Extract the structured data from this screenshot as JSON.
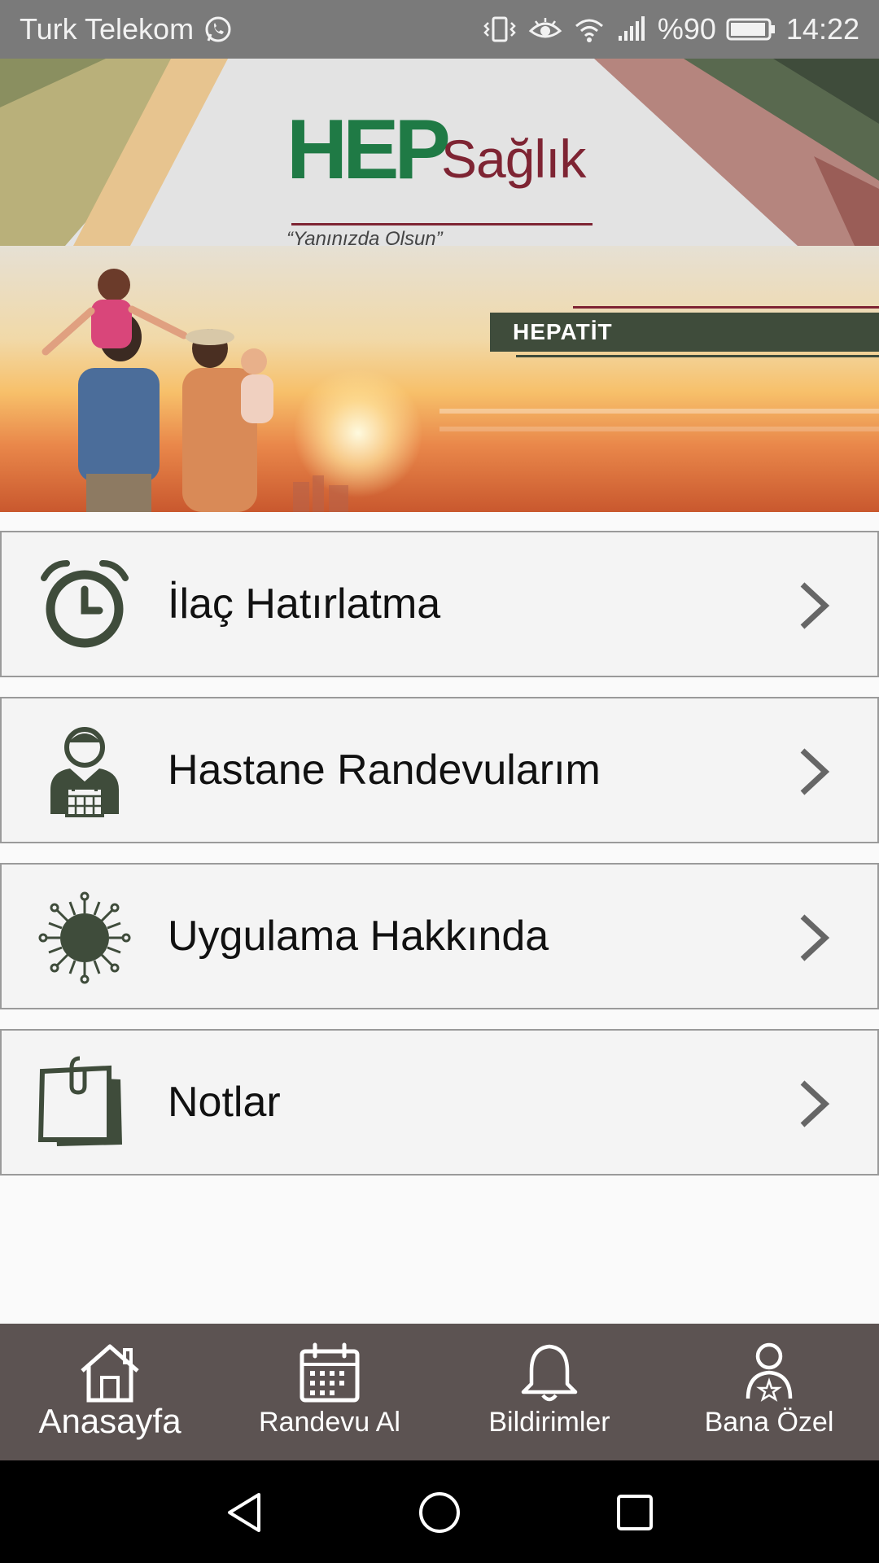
{
  "status_bar": {
    "carrier": "Turk Telekom",
    "battery": "%90",
    "time": "14:22",
    "icons": [
      "whatsapp-icon",
      "vibrate-icon",
      "eye-comfort-icon",
      "wifi-icon",
      "signal-icon",
      "battery-icon"
    ]
  },
  "header": {
    "logo_primary": "HEP",
    "logo_secondary": "Sağlık",
    "slogan": "“Yanınızda Olsun”"
  },
  "banner": {
    "tag": "HEPATİT"
  },
  "menu": {
    "items": [
      {
        "label": "İlaç Hatırlatma",
        "icon": "alarm-clock-icon"
      },
      {
        "label": "Hastane Randevularım",
        "icon": "doctor-calendar-icon"
      },
      {
        "label": "Uygulama Hakkında",
        "icon": "virus-icon"
      },
      {
        "label": "Notlar",
        "icon": "notes-icon"
      }
    ]
  },
  "bottom_nav": {
    "items": [
      {
        "label": "Anasayfa",
        "icon": "home-icon",
        "active": true
      },
      {
        "label": "Randevu Al",
        "icon": "calendar-icon",
        "active": false
      },
      {
        "label": "Bildirimler",
        "icon": "bell-icon",
        "active": false
      },
      {
        "label": "Bana Özel",
        "icon": "user-star-icon",
        "active": false
      }
    ]
  },
  "colors": {
    "brand_green": "#1f7a45",
    "brand_maroon": "#7e2433",
    "icon_dark_green": "#3f4c3b",
    "bottom_nav_bg": "#5c5352",
    "status_bar_bg": "#7a7a7a"
  }
}
